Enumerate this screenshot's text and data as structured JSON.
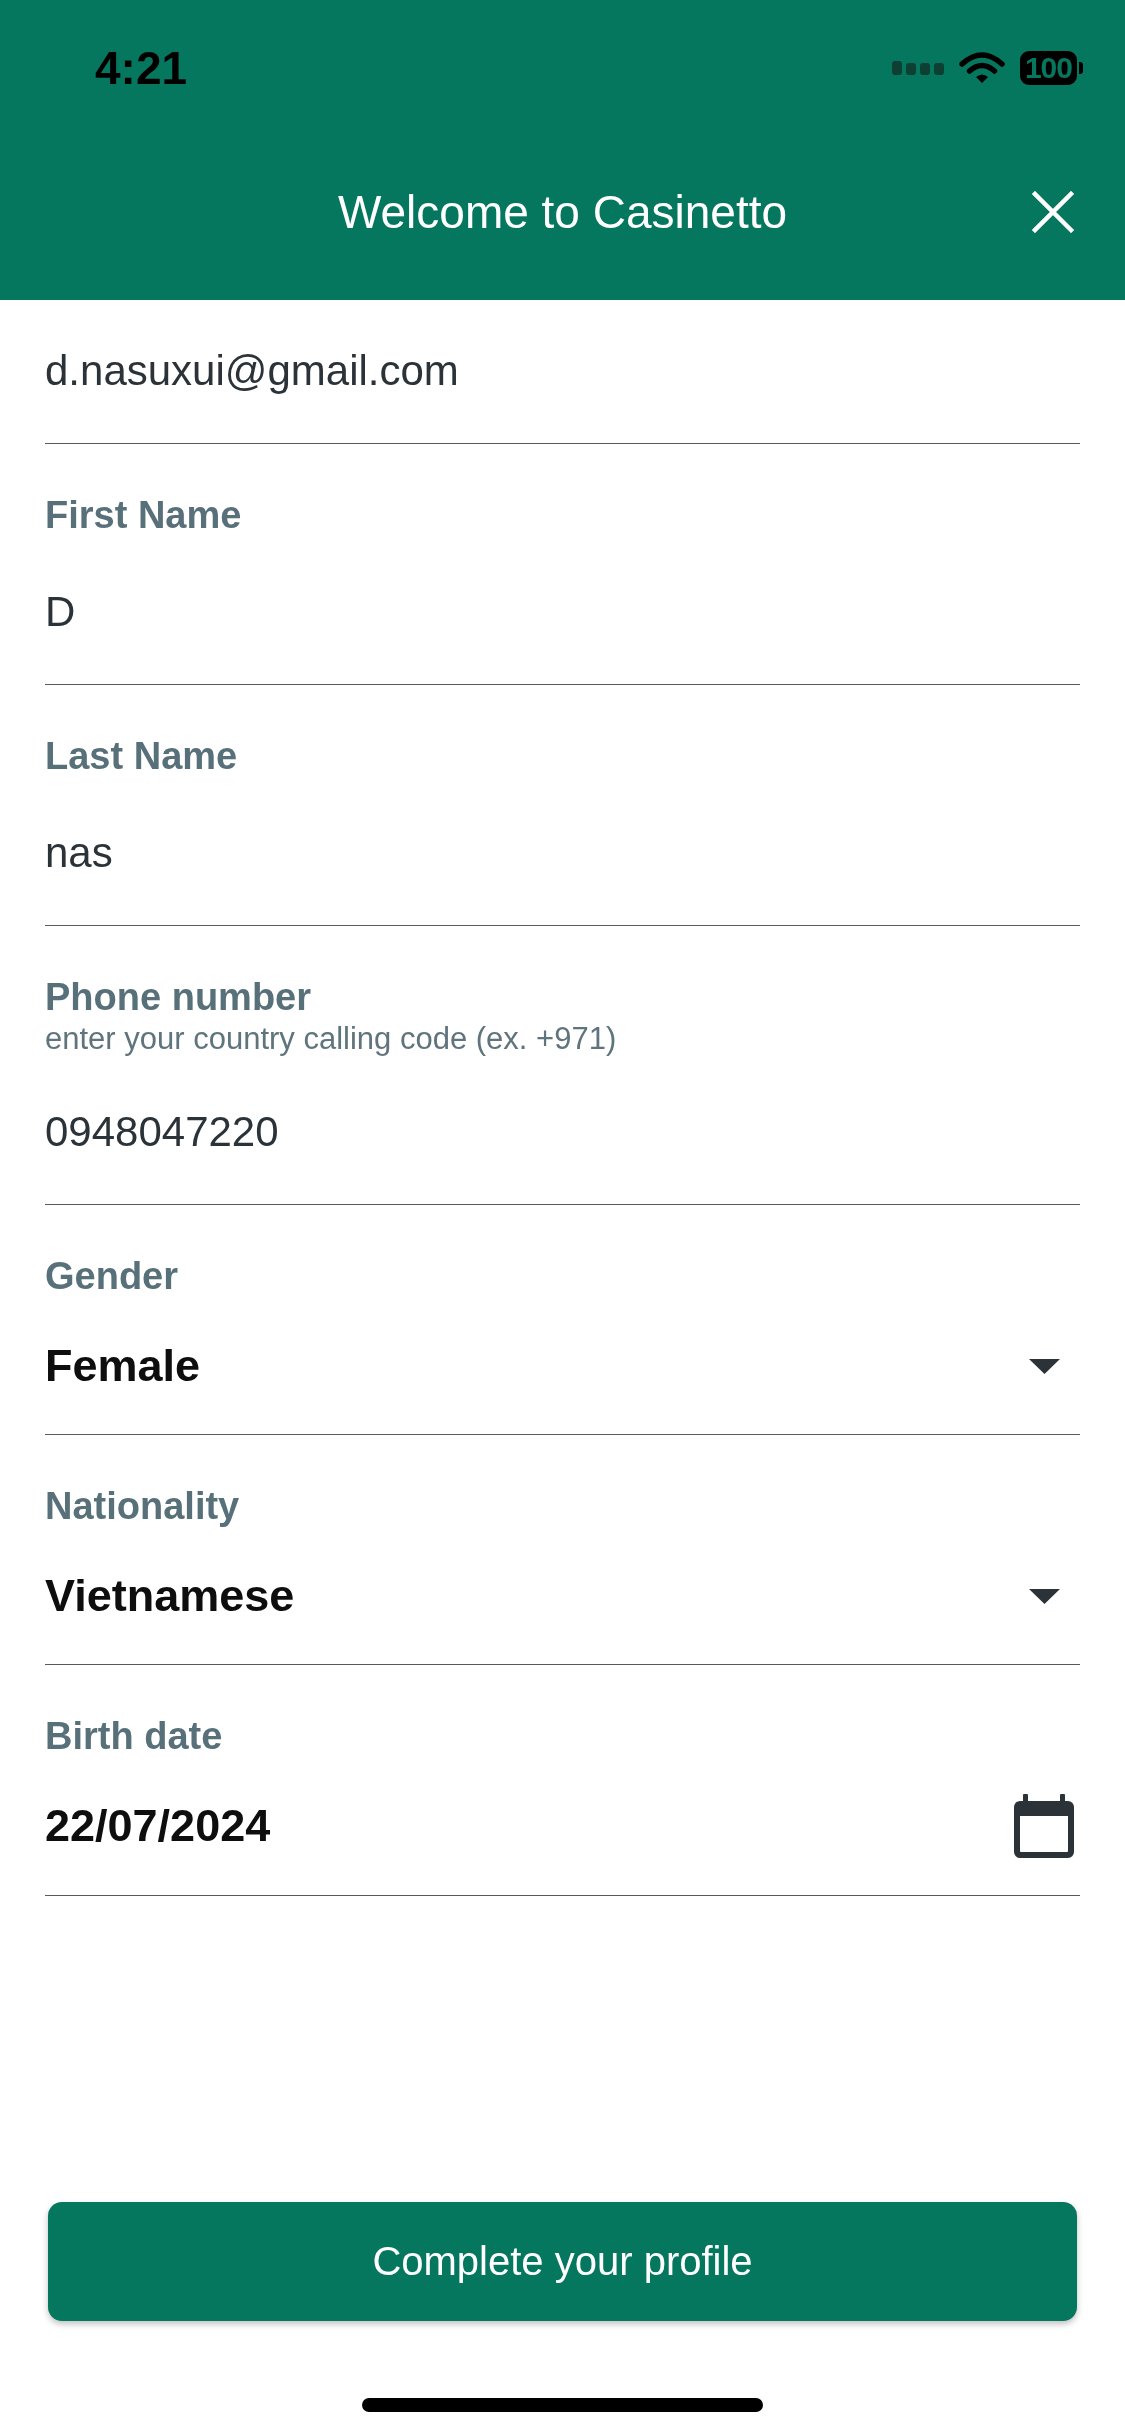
{
  "status_bar": {
    "time": "4:21",
    "battery": "100"
  },
  "header": {
    "title": "Welcome to Casinetto"
  },
  "fields": [
    {
      "kind": "text",
      "value": "d.nasuxui@gmail.com"
    },
    {
      "kind": "text",
      "label": "First Name",
      "value": "D"
    },
    {
      "kind": "text",
      "label": "Last Name",
      "value": "nas"
    },
    {
      "kind": "text",
      "label": "Phone number",
      "hint": "enter your country calling code (ex. +971)",
      "value": "0948047220"
    },
    {
      "kind": "select",
      "label": "Gender",
      "value": "Female"
    },
    {
      "kind": "select",
      "label": "Nationality",
      "value": "Vietnamese"
    },
    {
      "kind": "date",
      "label": "Birth date",
      "value": "22/07/2024"
    }
  ],
  "button": {
    "label": "Complete your profile"
  }
}
